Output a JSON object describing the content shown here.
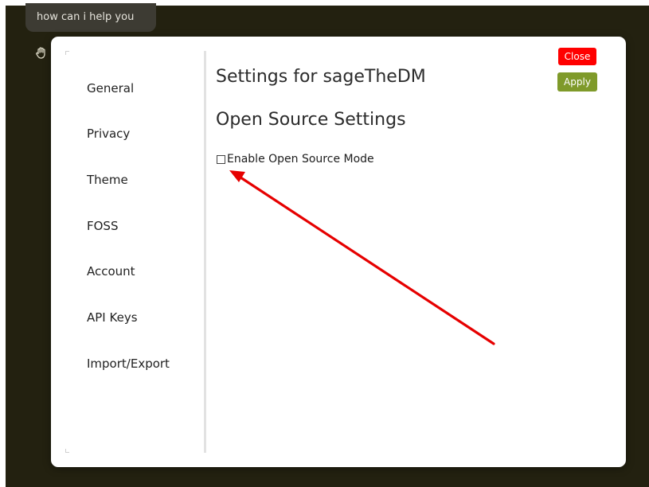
{
  "chat": {
    "bubble_text": "how can i help you"
  },
  "icons": {
    "hand": "hand-pointer-icon",
    "annotation": "red-arrow-annotation"
  },
  "settings": {
    "title": "Settings for sageTheDM",
    "section_title": "Open Source Settings",
    "option_label": "Enable Open Source Mode",
    "option_checked": false
  },
  "sidebar": {
    "items": [
      {
        "label": "General"
      },
      {
        "label": "Privacy"
      },
      {
        "label": "Theme"
      },
      {
        "label": "FOSS"
      },
      {
        "label": "Account"
      },
      {
        "label": "API Keys"
      },
      {
        "label": "Import/Export"
      }
    ]
  },
  "buttons": {
    "close_label": "Close",
    "apply_label": "Apply"
  },
  "colors": {
    "background": "#232110",
    "close_button": "#ff0000",
    "apply_button": "#7f9a2a",
    "annotation_arrow": "#e60000"
  }
}
